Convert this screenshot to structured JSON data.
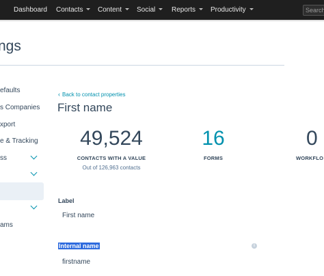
{
  "topnav": {
    "items": [
      {
        "label": "Dashboard",
        "has_caret": false
      },
      {
        "label": "Contacts",
        "has_caret": true
      },
      {
        "label": "Content",
        "has_caret": true
      },
      {
        "label": "Social",
        "has_caret": true
      },
      {
        "label": "Reports",
        "has_caret": true
      },
      {
        "label": "Productivity",
        "has_caret": true
      }
    ],
    "search_placeholder": "Search"
  },
  "header": {
    "title": "ngs"
  },
  "sidebar": {
    "items": [
      {
        "label": "efaults"
      },
      {
        "label": "s Companies"
      },
      {
        "label": "xport"
      },
      {
        "label": "e & Tracking"
      },
      {
        "label": "ss"
      },
      {
        "label": "ams"
      }
    ]
  },
  "main": {
    "back_link": "Back to contact properties",
    "property_title": "First name",
    "stats": [
      {
        "value": "49,524",
        "label": "CONTACTS WITH A VALUE",
        "sub": "Out of 126,963 contacts",
        "color": "#33475b"
      },
      {
        "value": "16",
        "label": "FORMS",
        "sub": "",
        "color": "#0091ae"
      },
      {
        "value": "0",
        "label": "WORKFLO",
        "sub": "",
        "color": "#33475b"
      }
    ],
    "label_field": {
      "label": "Label",
      "value": "First name"
    },
    "internal_name_field": {
      "label": "Internal name",
      "value": "firstname",
      "info_icon": "info-icon"
    }
  },
  "colors": {
    "nav_bg": "#1f1f1f",
    "accent": "#0091ae",
    "text": "#33475b",
    "selection": "#2e6bde"
  }
}
